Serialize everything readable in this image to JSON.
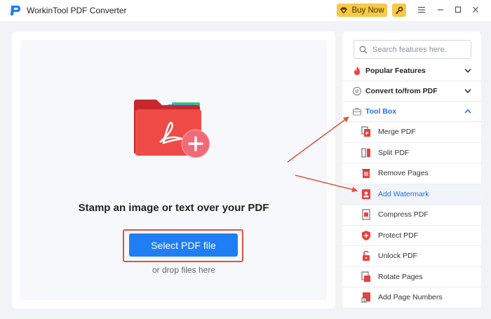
{
  "app": {
    "title": "WorkinTool PDF Converter",
    "buy_label": "Buy Now"
  },
  "main": {
    "headline": "Stamp an image or text over your PDF",
    "select_label": "Select PDF file",
    "drop_hint": "or drop files here"
  },
  "sidebar": {
    "search_placeholder": "Search features here.",
    "sections": [
      {
        "label": "Popular Features",
        "icon": "fire-icon",
        "expanded": false
      },
      {
        "label": "Convert to/from PDF",
        "icon": "convert-icon",
        "expanded": false
      },
      {
        "label": "Tool Box",
        "icon": "toolbox-icon",
        "expanded": true
      }
    ],
    "tools": [
      {
        "label": "Merge PDF",
        "icon": "merge-pdf-icon"
      },
      {
        "label": "Split PDF",
        "icon": "split-pdf-icon"
      },
      {
        "label": "Remove Pages",
        "icon": "remove-pages-icon"
      },
      {
        "label": "Add Watermark",
        "icon": "watermark-icon",
        "active": true
      },
      {
        "label": "Compress PDF",
        "icon": "compress-pdf-icon"
      },
      {
        "label": "Protect PDF",
        "icon": "protect-pdf-icon"
      },
      {
        "label": "Unlock PDF",
        "icon": "unlock-pdf-icon"
      },
      {
        "label": "Rotate Pages",
        "icon": "rotate-pages-icon"
      },
      {
        "label": "Add Page Numbers",
        "icon": "page-numbers-icon"
      }
    ]
  },
  "colors": {
    "accent": "#1f7ef4",
    "active_text": "#1f6fe8",
    "annotation_red": "#e0523f",
    "buy_yellow": "#f7c948",
    "pdf_red": "#e8413f"
  }
}
